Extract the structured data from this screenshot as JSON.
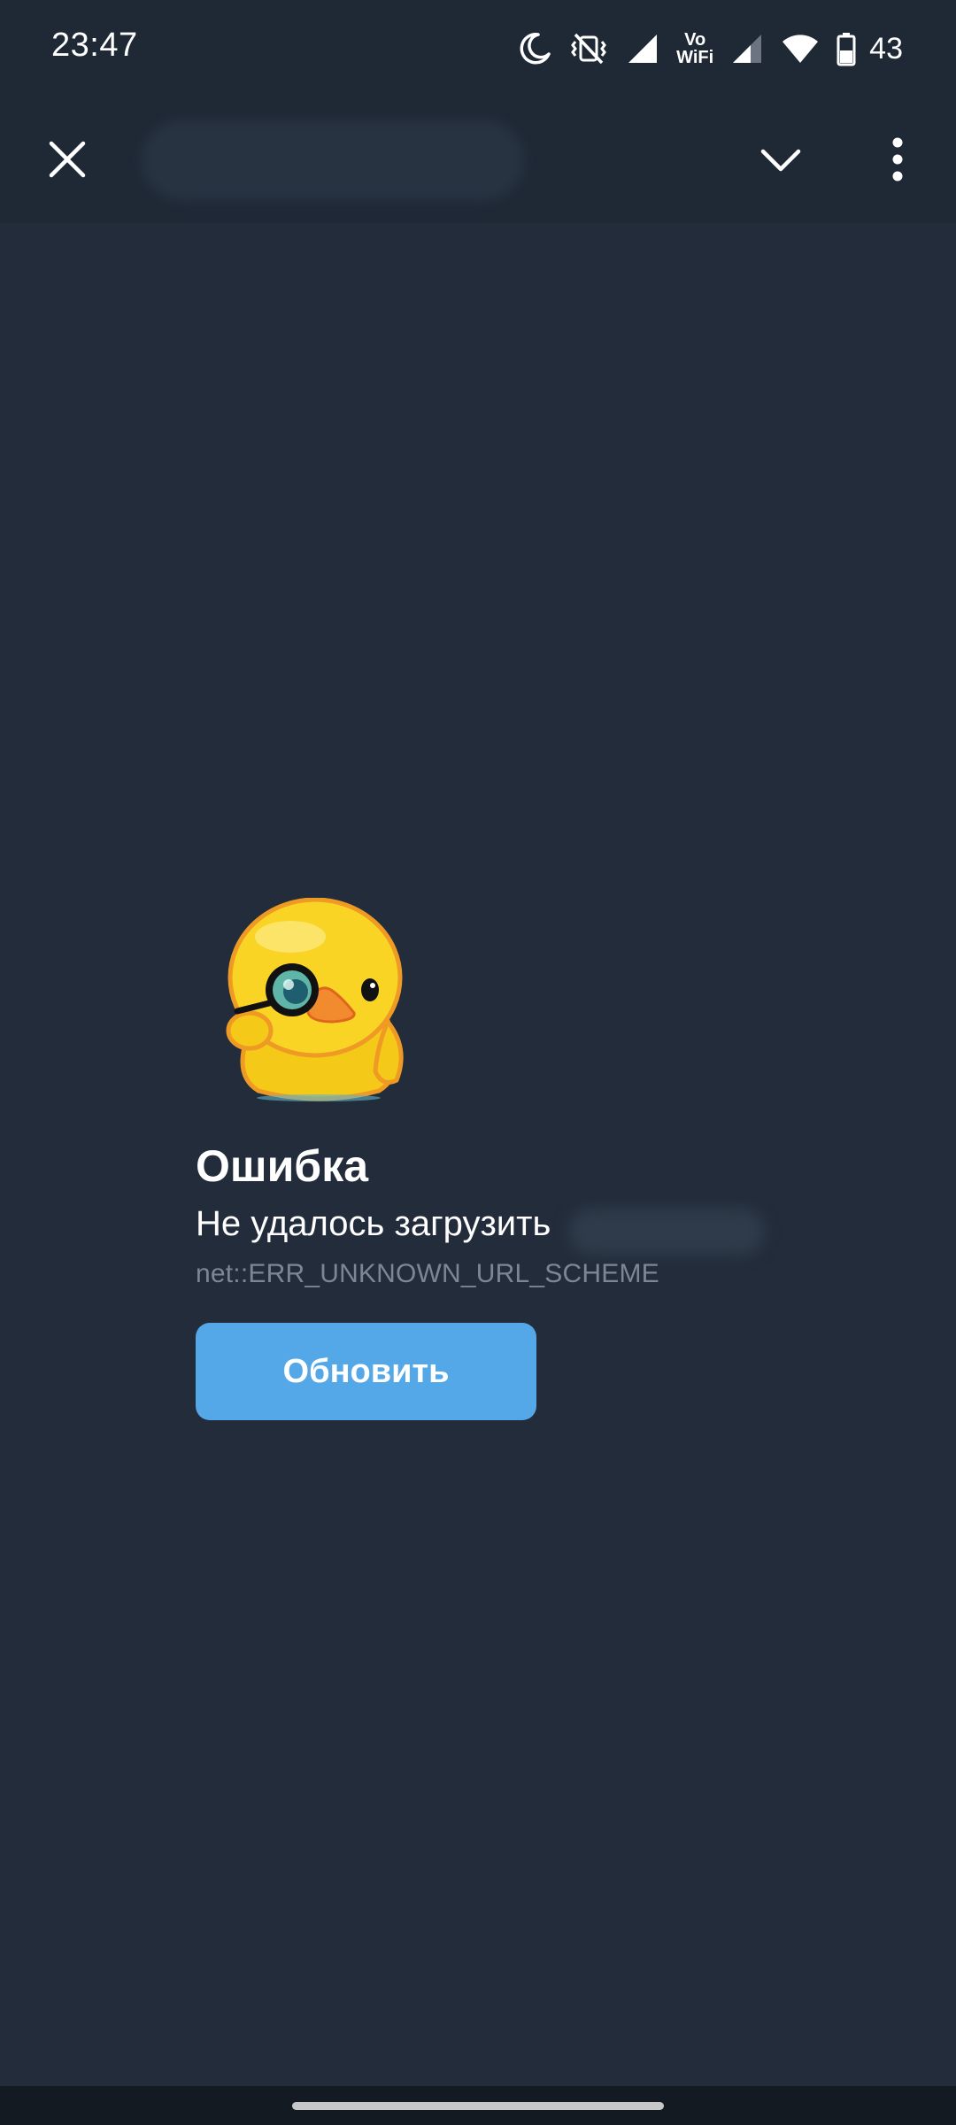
{
  "status_bar": {
    "time": "23:47",
    "vowifi_top": "Vo",
    "vowifi_bottom": "WiFi",
    "battery": "43",
    "icons": [
      "moon-icon",
      "vibrate-off-icon",
      "cell-signal-icon",
      "vowifi-icon",
      "cell-signal-2-icon",
      "wifi-icon",
      "battery-icon"
    ]
  },
  "toolbar": {
    "icons": [
      "close-icon",
      "chevron-down-icon",
      "more-vertical-icon"
    ]
  },
  "error": {
    "title": "Ошибка",
    "message": "Не удалось загрузить",
    "code": "net::ERR_UNKNOWN_URL_SCHEME",
    "button_label": "Обновить",
    "illustration": "duck-with-monocle-sticker"
  },
  "colors": {
    "background": "#222c3a",
    "toolbar": "#1f2936",
    "accent_button": "#55a8e8",
    "muted_text": "#7d8793"
  }
}
